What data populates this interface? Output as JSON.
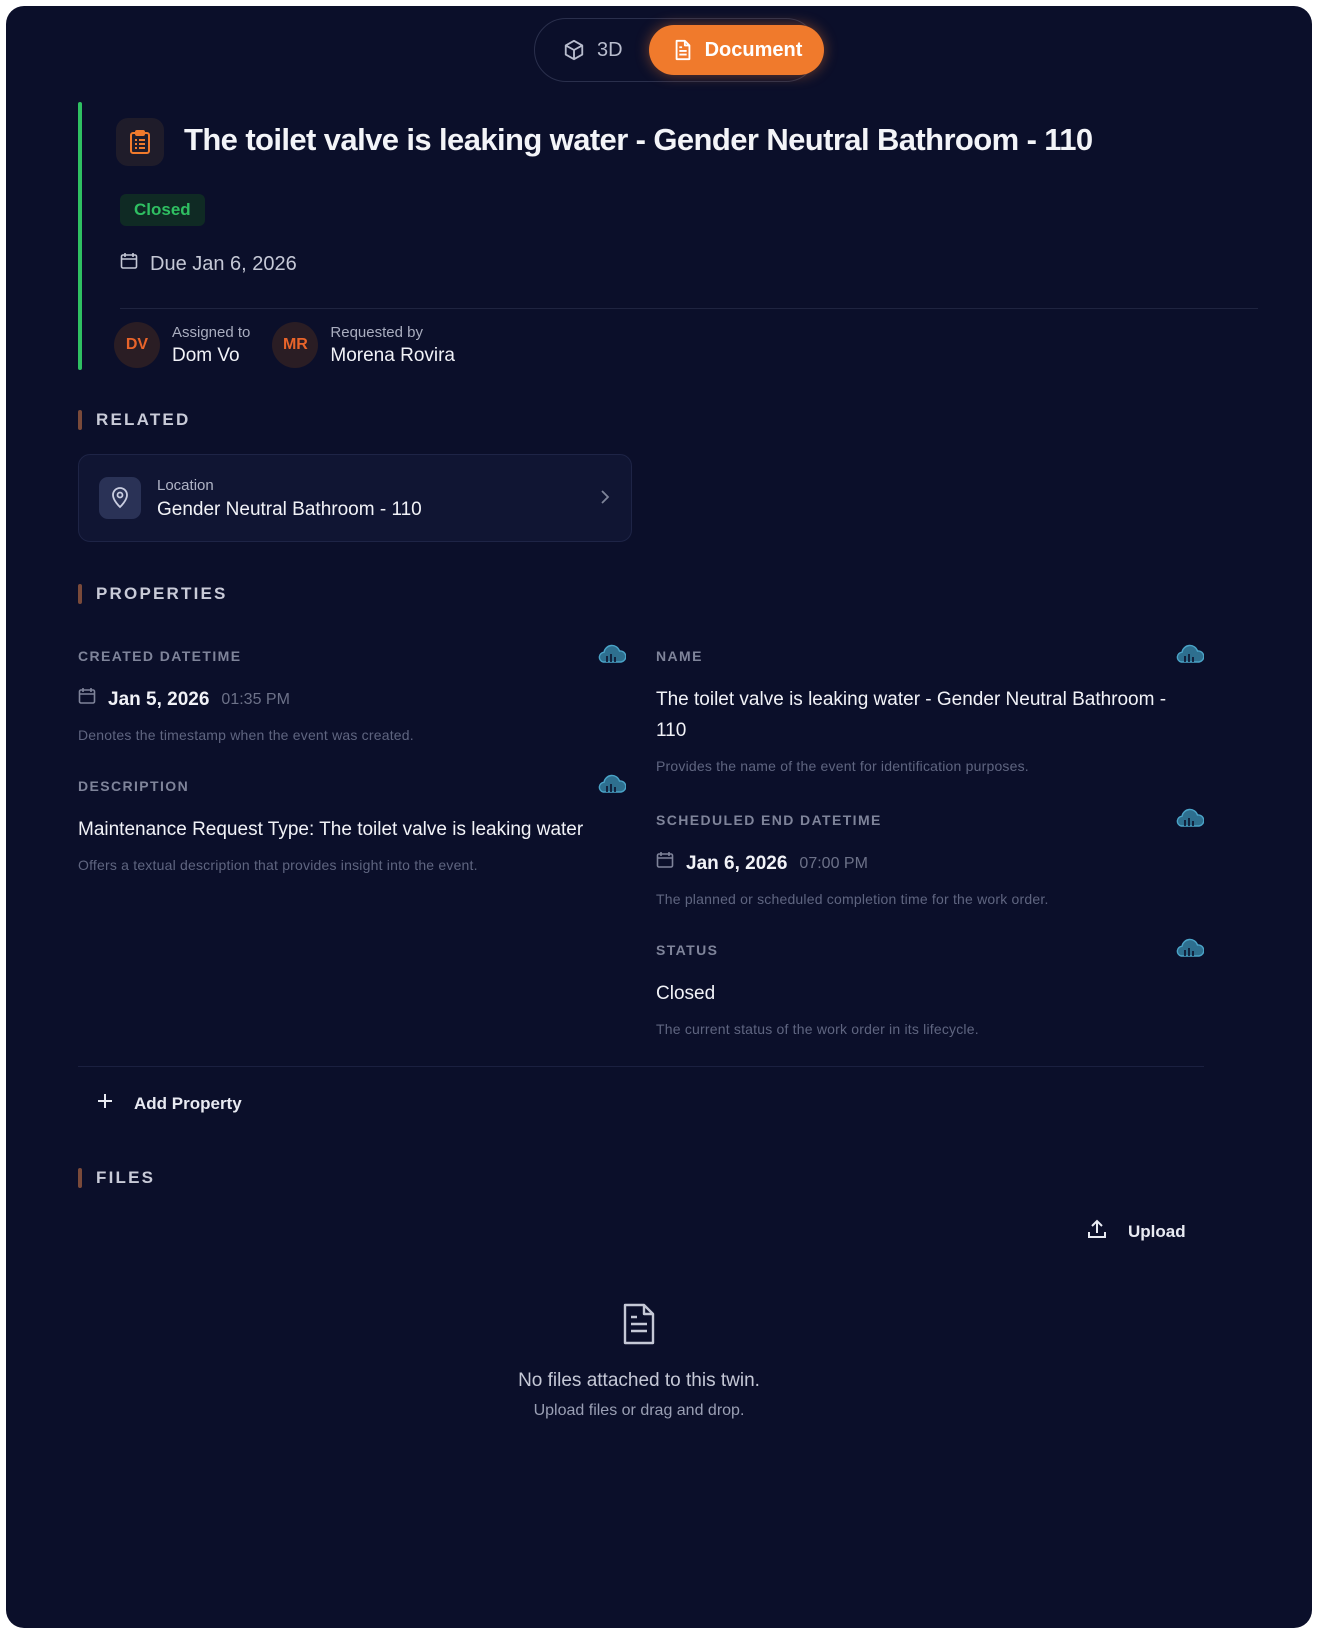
{
  "toggle": {
    "options": [
      {
        "label": "3D",
        "icon": "cube-icon",
        "active": false
      },
      {
        "label": "Document",
        "icon": "document-icon",
        "active": true
      }
    ],
    "accent": "#f07a2c"
  },
  "header": {
    "icon": "clipboard-icon",
    "title": "The toilet valve is leaking water - Gender Neutral Bathroom - 110",
    "status": "Closed",
    "status_color": "#2fbf62",
    "due": "Due Jan 6, 2026",
    "assigned": {
      "role": "Assigned to",
      "initials": "DV",
      "name": "Dom Vo"
    },
    "requested": {
      "role": "Requested by",
      "initials": "MR",
      "name": "Morena Rovira"
    }
  },
  "related": {
    "heading": "RELATED",
    "location_label": "Location",
    "location_value": "Gender Neutral Bathroom - 110"
  },
  "properties": {
    "heading": "PROPERTIES",
    "created": {
      "label": "CREATED DATETIME",
      "date": "Jan 5, 2026",
      "time": "01:35 PM",
      "description": "Denotes the timestamp when the event was created."
    },
    "description": {
      "label": "DESCRIPTION",
      "value": "Maintenance Request Type: The toilet valve is leaking water",
      "description": "Offers a textual description that provides insight into the event."
    },
    "name": {
      "label": "NAME",
      "value": "The toilet valve is leaking water - Gender Neutral Bathroom - 110",
      "description": "Provides the name of the event for identification purposes."
    },
    "scheduled_end": {
      "label": "SCHEDULED END DATETIME",
      "date": "Jan 6, 2026",
      "time": "07:00 PM",
      "description": "The planned or scheduled completion time for the work order."
    },
    "status": {
      "label": "STATUS",
      "value": "Closed",
      "description": "The current status of the work order in its lifecycle."
    },
    "add_label": "Add Property"
  },
  "files": {
    "heading": "FILES",
    "upload_label": "Upload",
    "empty_title": "No files attached to this twin.",
    "empty_sub": "Upload files or drag and drop."
  }
}
